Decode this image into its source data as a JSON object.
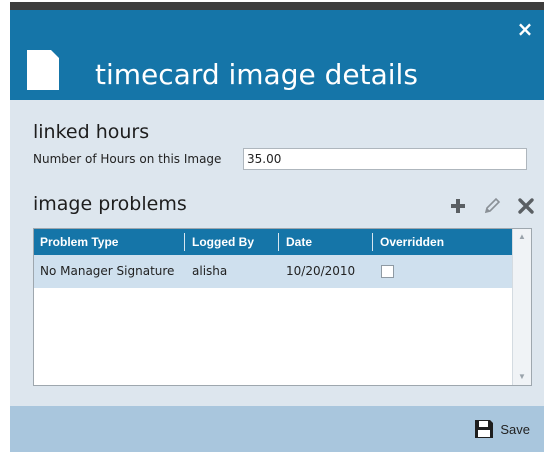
{
  "dialog": {
    "title": "timecard image details",
    "close_label": "×"
  },
  "linked_hours": {
    "section_title": "linked hours",
    "field_label": "Number of Hours on this Image",
    "field_value": "35.00"
  },
  "image_problems": {
    "section_title": "image problems",
    "toolbar": {
      "icons": [
        "add-icon",
        "edit-icon",
        "delete-icon"
      ]
    },
    "columns": [
      "Problem Type",
      "Logged By",
      "Date",
      "Overridden"
    ],
    "rows": [
      {
        "problem_type": "No Manager Signature",
        "logged_by": "alisha",
        "date": "10/20/2010",
        "overridden": false
      }
    ]
  },
  "footer": {
    "save_label": "Save"
  },
  "colors": {
    "header_blue": "#1575a8",
    "body_bg": "#dde6ee",
    "row_selected": "#cfe0ee",
    "footer_bg": "#a9c6dd"
  }
}
